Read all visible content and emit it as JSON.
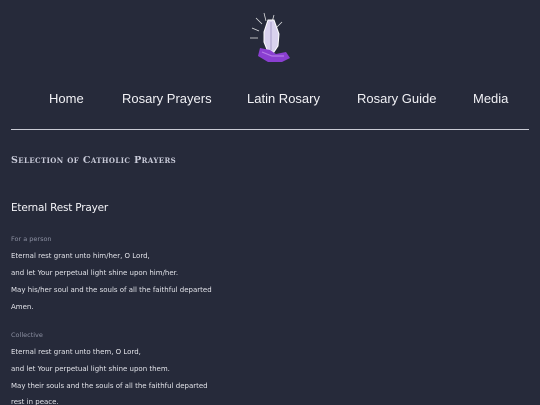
{
  "logo": {
    "icon": "praying-hands-icon",
    "accent": "#8a3fd1"
  },
  "nav": {
    "items": [
      {
        "label": "Home"
      },
      {
        "label": "Rosary Prayers"
      },
      {
        "label": "Latin Rosary"
      },
      {
        "label": "Rosary Guide"
      },
      {
        "label": "Media"
      }
    ]
  },
  "section": {
    "title": "Selection of Catholic Prayers"
  },
  "prayer": {
    "title": "Eternal Rest Prayer",
    "groups": [
      {
        "label": "For a person",
        "lines": [
          "Eternal rest grant unto him/her, O Lord,",
          "and let Your perpetual light shine upon him/her.",
          "May his/her soul and the souls of all the faithful departed",
          "Amen."
        ]
      },
      {
        "label": "Collective",
        "lines": [
          "Eternal rest grant unto them, O Lord,",
          "and let Your perpetual light shine upon them.",
          "May their souls and the souls of all the faithful departed",
          "rest in peace."
        ]
      }
    ]
  }
}
